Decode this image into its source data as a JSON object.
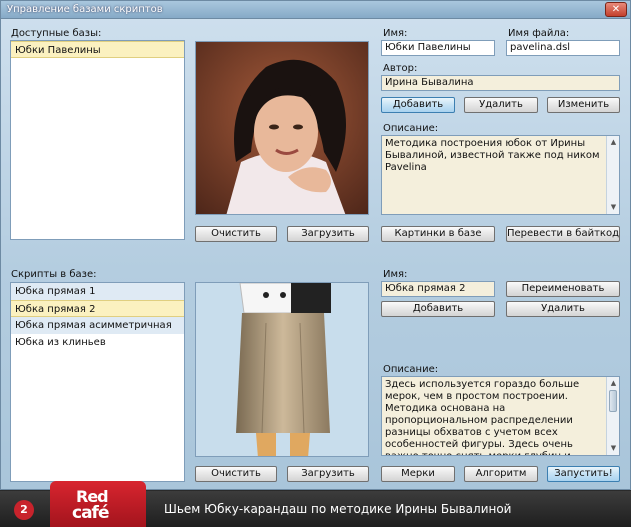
{
  "window": {
    "title": "Управление базами скриптов",
    "close_label": "✕"
  },
  "bases": {
    "label": "Доступные базы:",
    "items": [
      "Юбки Павелины"
    ],
    "selected_index": 0
  },
  "base_details": {
    "name_label": "Имя:",
    "name_value": "Юбки Павелины",
    "file_label": "Имя файла:",
    "file_value": "pavelina.dsl",
    "author_label": "Автор:",
    "author_value": "Ирина Бывалина",
    "add_label": "Добавить",
    "delete_label": "Удалить",
    "edit_label": "Изменить",
    "description_label": "Описание:",
    "description_value": "Методика построения юбок от Ирины Бывалиной, известной также под ником Pavelina"
  },
  "base_photo_buttons": {
    "clear_label": "Очистить",
    "load_label": "Загрузить"
  },
  "base_actions": {
    "pictures_label": "Картинки в базе",
    "bytecode_label": "Перевести в байткод"
  },
  "scripts": {
    "label": "Скрипты в базе:",
    "items": [
      "Юбка прямая 1",
      "Юбка прямая 2",
      "Юбка прямая асимметричная",
      "Юбка из клиньев"
    ],
    "selected_index": 1
  },
  "script_details": {
    "name_label": "Имя:",
    "name_value": "Юбка прямая 2",
    "rename_label": "Переименовать",
    "add_label": "Добавить",
    "delete_label": "Удалить",
    "description_label": "Описание:",
    "description_value": "Здесь используется гораздо больше мерок, чем в простом построении. Методика основана на пропорциональном распределении разницы обхватов с учетом всех особенностей фигуры. Здесь очень важно точно снять мерки глубин и"
  },
  "script_photo_buttons": {
    "clear_label": "Очистить",
    "load_label": "Загрузить"
  },
  "script_actions": {
    "measures_label": "Мерки",
    "algorithm_label": "Алгоритм",
    "run_label": "Запустить!"
  },
  "footer": {
    "badge": "2",
    "logo_top": "Red",
    "logo_bottom": "café",
    "caption": "Шьем Юбку-карандаш по методике Ирины Бывалиной"
  }
}
